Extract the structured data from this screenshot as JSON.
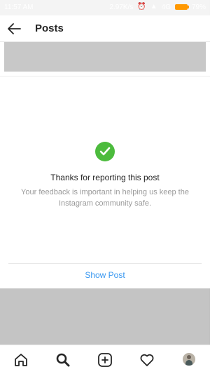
{
  "status_bar": {
    "time": "11:57 AM",
    "net_speed": "2.97K/s",
    "network": "4G",
    "battery_pct": "79%",
    "battery_color": "#ff9800"
  },
  "header": {
    "title": "Posts",
    "back_icon": "arrow-left-icon"
  },
  "report_card": {
    "icon": "checkmark-circle-icon",
    "icon_color": "#4cbb3d",
    "thanks_text": "Thanks for reporting this post",
    "feedback_text": "Your feedback is important in helping us keep the Instagram community safe.",
    "show_post_label": "Show Post",
    "link_color": "#3897f0"
  },
  "tab_bar": {
    "items": [
      "home-icon",
      "search-icon",
      "new-post-icon",
      "activity-heart-icon",
      "profile-avatar"
    ]
  }
}
